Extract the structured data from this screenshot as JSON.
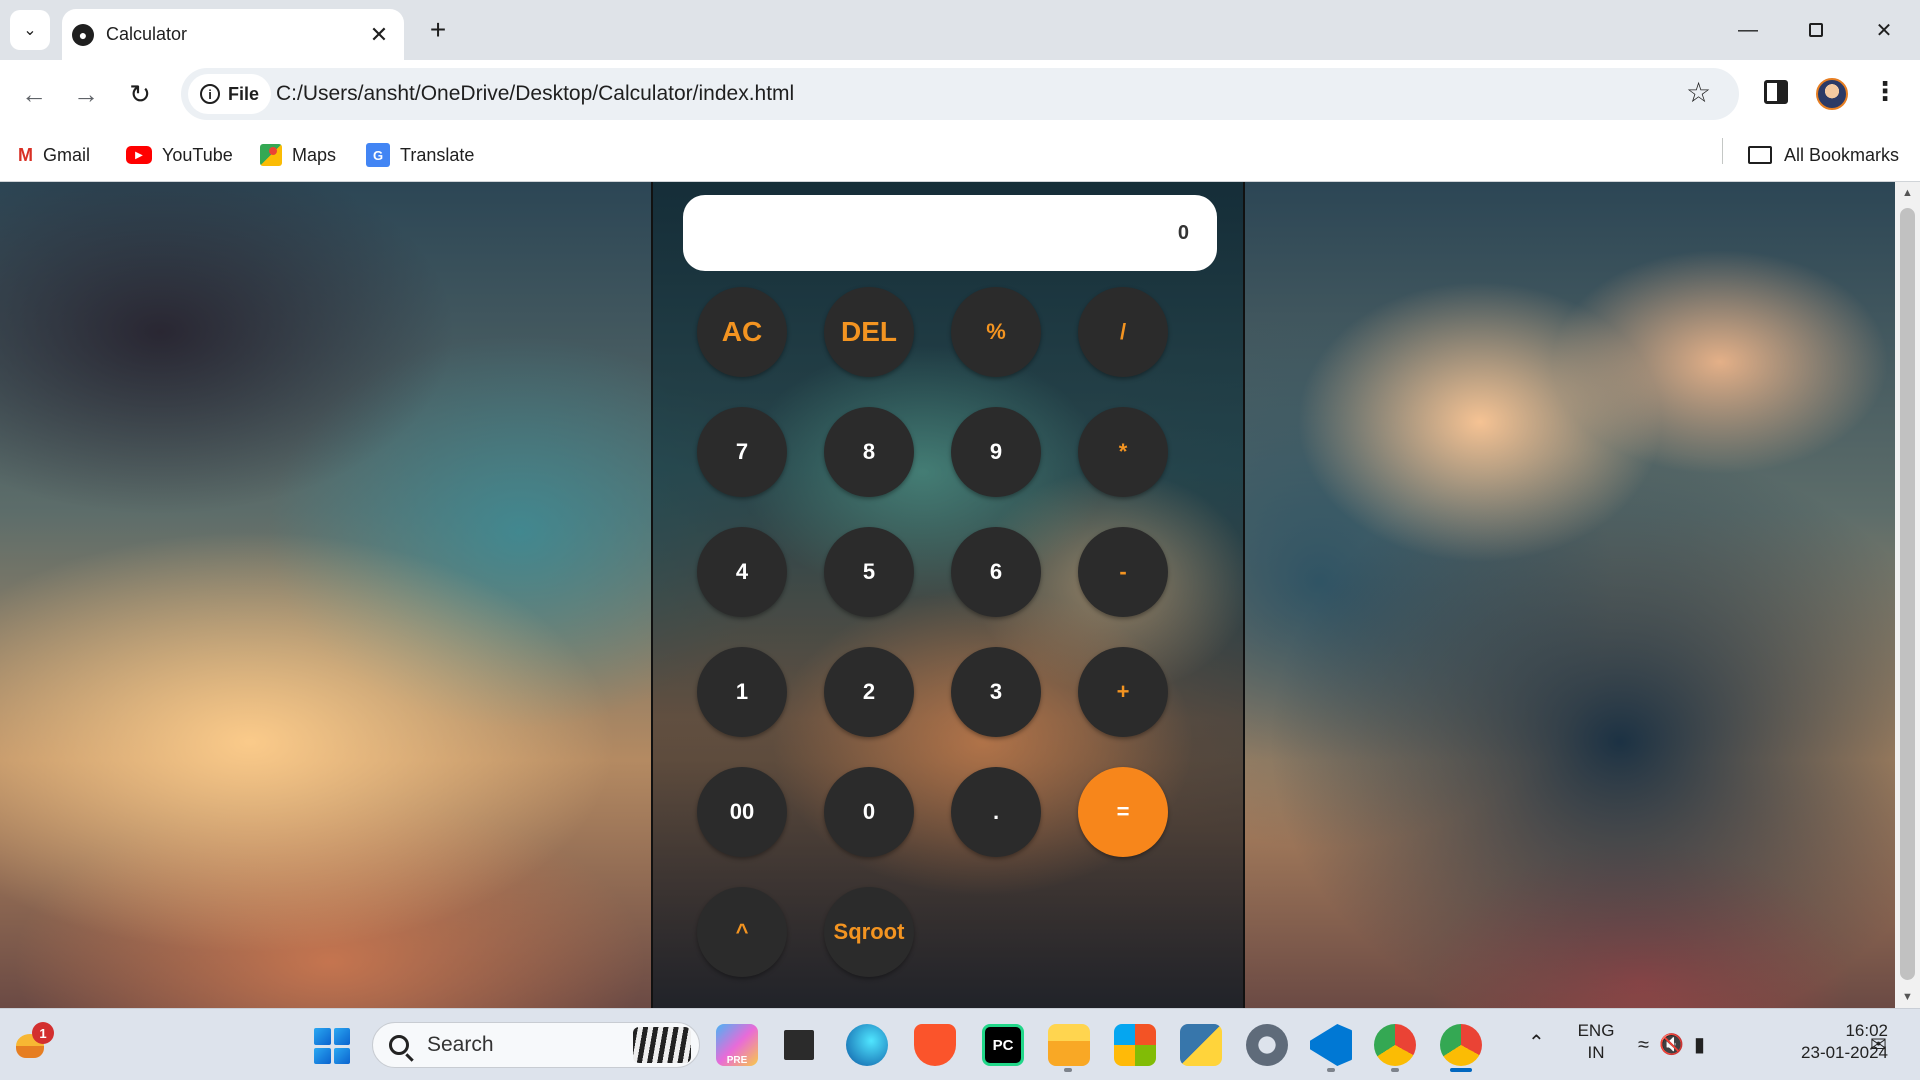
{
  "browser": {
    "tab_title": "Calculator",
    "address_chip": "File",
    "url": "C:/Users/ansht/OneDrive/Desktop/Calculator/index.html",
    "icons": {
      "tab_menu": "chevron-down-icon",
      "tab_close": "close-icon",
      "new_tab": "plus-icon",
      "back": "back-arrow-icon",
      "forward": "forward-arrow-icon",
      "reload": "reload-icon",
      "bookmark_star": "star-icon",
      "side_panel": "side-panel-icon",
      "menu": "more-vertical-icon"
    },
    "bookmarks": [
      {
        "label": "Gmail",
        "icon": "gmail-icon"
      },
      {
        "label": "YouTube",
        "icon": "youtube-icon"
      },
      {
        "label": "Maps",
        "icon": "maps-icon"
      },
      {
        "label": "Translate",
        "icon": "translate-icon"
      }
    ],
    "all_bookmarks_label": "All Bookmarks"
  },
  "calculator": {
    "display_value": "0",
    "accent_color": "#f7861b",
    "key_color": "#2b2b2b",
    "rows": [
      [
        {
          "label": "AC",
          "type": "op"
        },
        {
          "label": "DEL",
          "type": "op"
        },
        {
          "label": "%",
          "type": "op"
        },
        {
          "label": "/",
          "type": "op"
        }
      ],
      [
        {
          "label": "7",
          "type": "num"
        },
        {
          "label": "8",
          "type": "num"
        },
        {
          "label": "9",
          "type": "num"
        },
        {
          "label": "*",
          "type": "op"
        }
      ],
      [
        {
          "label": "4",
          "type": "num"
        },
        {
          "label": "5",
          "type": "num"
        },
        {
          "label": "6",
          "type": "num"
        },
        {
          "label": "-",
          "type": "op"
        }
      ],
      [
        {
          "label": "1",
          "type": "num"
        },
        {
          "label": "2",
          "type": "num"
        },
        {
          "label": "3",
          "type": "num"
        },
        {
          "label": "+",
          "type": "op"
        }
      ],
      [
        {
          "label": "00",
          "type": "num"
        },
        {
          "label": "0",
          "type": "num"
        },
        {
          "label": ".",
          "type": "num"
        },
        {
          "label": "=",
          "type": "equals"
        }
      ],
      [
        {
          "label": "^",
          "type": "op"
        },
        {
          "label": "Sqroot",
          "type": "op"
        }
      ]
    ]
  },
  "taskbar": {
    "widget_badge": "1",
    "search_placeholder": "Search",
    "apps": [
      "copilot-icon",
      "terminal-icon",
      "edge-icon",
      "brave-icon",
      "pycharm-icon",
      "file-explorer-icon",
      "store-icon",
      "python-icon",
      "settings-icon",
      "vscode-icon",
      "chrome-icon",
      "chrome-active-icon"
    ],
    "pycharm_label": "PC",
    "copilot_label": "PRE",
    "lang_line1": "ENG",
    "lang_line2": "IN",
    "time": "16:02",
    "date": "23-01-2024"
  }
}
